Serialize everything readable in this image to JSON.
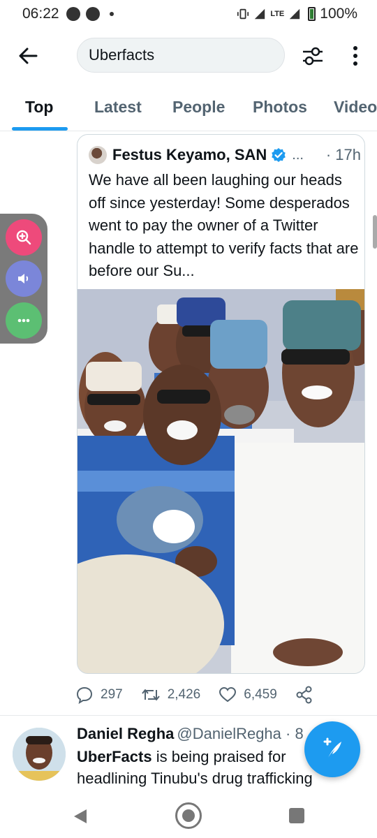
{
  "status_bar": {
    "time": "06:22",
    "network": "LTE",
    "battery": "100%"
  },
  "search": {
    "query": "Uberfacts"
  },
  "tabs": [
    {
      "label": "Top",
      "active": true
    },
    {
      "label": "Latest",
      "active": false
    },
    {
      "label": "People",
      "active": false
    },
    {
      "label": "Photos",
      "active": false
    },
    {
      "label": "Video",
      "active": false
    }
  ],
  "quoted_tweet": {
    "author": "Festus Keyamo, SAN",
    "more": "...",
    "time": "· 17h",
    "text": "We have all been laughing our heads off since yesterday! Some desperados went to pay the owner of a Twitter handle to attempt to verify facts that are before our Su..."
  },
  "engagement": {
    "replies": "297",
    "retweets": "2,426",
    "likes": "6,459"
  },
  "next_tweet": {
    "name": "Daniel Regha",
    "handle": "@DanielRegha · 8",
    "highlight": "UberFacts",
    "text": " is being praised for headlining Tinubu's drug trafficking"
  },
  "colors": {
    "accent": "#1d9bf0",
    "text": "#0f1419",
    "muted": "#536471",
    "zoom": "#ee4a7b",
    "sound": "#7b86d9",
    "more": "#5cbf73"
  },
  "icons": [
    "back-arrow-icon",
    "filter-icon",
    "more-vertical-icon",
    "verified-icon",
    "reply-icon",
    "retweet-icon",
    "like-icon",
    "share-icon",
    "compose-icon",
    "zoom-icon",
    "sound-icon",
    "dots-icon"
  ]
}
